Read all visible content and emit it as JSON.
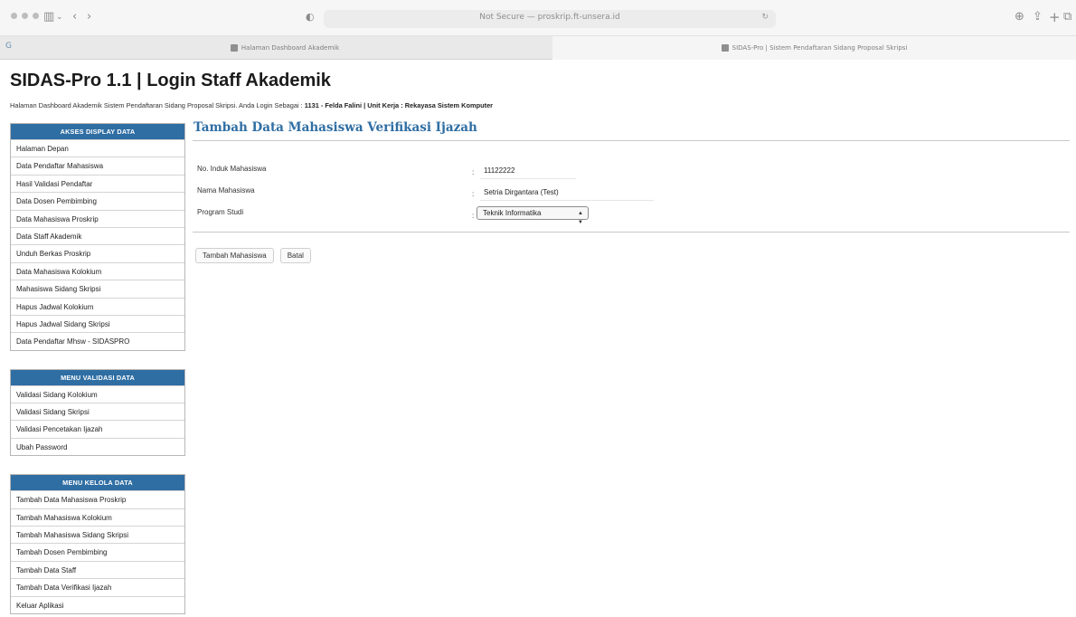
{
  "browser": {
    "address": "Not Secure — proskrip.ft-unsera.id",
    "tabs": [
      {
        "label": "Halaman Dashboard Akademik"
      },
      {
        "label": "SIDAS-Pro | Sistem Pendaftaran Sidang Proposal Skripsi"
      }
    ]
  },
  "header": {
    "title": "SIDAS-Pro 1.1 | Login Staff Akademik",
    "info_prefix": "Halaman Dashboard Akademik Sistem Pendaftaran Sidang Proposal Skripsi. Anda Login Sebagai : ",
    "info_user": "1131 - Felda Falini | Unit Kerja : Rekayasa Sistem Komputer"
  },
  "sidebar": {
    "display": {
      "heading": "AKSES DISPLAY DATA",
      "items": [
        "Halaman Depan",
        "Data Pendaftar Mahasiswa",
        "Hasil Validasi Pendaftar",
        "Data Dosen Pembimbing",
        "Data Mahasiswa Proskrip",
        "Data Staff Akademik",
        "Unduh Berkas Proskrip",
        "Data Mahasiswa Kolokium",
        "Mahasiswa Sidang Skripsi",
        "Hapus Jadwal Kolokium",
        "Hapus Jadwal Sidang Skripsi",
        "Data Pendaftar Mhsw - SIDASPRO"
      ]
    },
    "validasi": {
      "heading": "MENU VALIDASI DATA",
      "items": [
        "Validasi Sidang Kolokium",
        "Validasi Sidang Skripsi",
        "Validasi Pencetakan Ijazah",
        "Ubah Password"
      ]
    },
    "kelola": {
      "heading": "MENU KELOLA DATA",
      "items": [
        "Tambah Data Mahasiswa Proskrip",
        "Tambah Mahasiswa Kolokium",
        "Tambah Mahasiswa Sidang Skripsi",
        "Tambah Dosen Pembimbing",
        "Tambah Data Staff",
        "Tambah Data Verifikasi Ijazah",
        "Keluar Aplikasi"
      ]
    }
  },
  "main": {
    "title": "Tambah Data Mahasiswa Verifikasi Ijazah",
    "form": {
      "nim_label": "No. Induk Mahasiswa",
      "nim_value": "11122222",
      "nama_label": "Nama Mahasiswa",
      "nama_value": "Setria Dirgantara (Test)",
      "prodi_label": "Program Studi",
      "prodi_value": "Teknik Informatika",
      "colon": ":"
    },
    "buttons": {
      "submit": "Tambah Mahasiswa",
      "cancel": "Batal"
    }
  }
}
